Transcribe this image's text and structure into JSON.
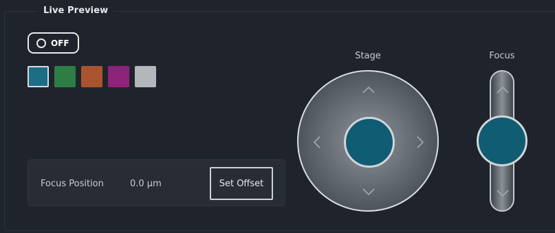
{
  "panel": {
    "title": "Live Preview"
  },
  "toggle": {
    "label": "OFF"
  },
  "swatches": [
    {
      "color": "#1c6e86",
      "selected": true
    },
    {
      "color": "#2d7d45",
      "selected": false
    },
    {
      "color": "#a9542f",
      "selected": false
    },
    {
      "color": "#8e237a",
      "selected": false
    },
    {
      "color": "#b3b6ba",
      "selected": false
    }
  ],
  "focus_position": {
    "label": "Focus Position",
    "value": "0.0 µm",
    "button": "Set Offset"
  },
  "stage": {
    "label": "Stage",
    "arrows": {
      "up": "^",
      "down": "v",
      "left": "<",
      "right": ">"
    }
  },
  "focus": {
    "label": "Focus",
    "arrows": {
      "up": "^",
      "down": "v"
    }
  }
}
